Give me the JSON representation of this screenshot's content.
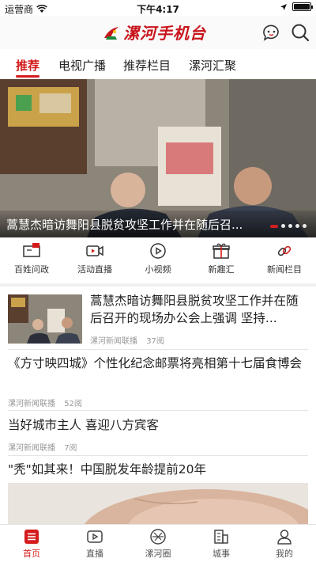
{
  "status_bar": {
    "carrier": "运营商",
    "time": "下午4:17"
  },
  "header": {
    "app_title": "漯河手机台"
  },
  "tabs": [
    {
      "label": "推荐",
      "active": true
    },
    {
      "label": "电视广播",
      "active": false
    },
    {
      "label": "推荐栏目",
      "active": false
    },
    {
      "label": "漯河汇聚",
      "active": false
    }
  ],
  "banner": {
    "title": "蒿慧杰暗访舞阳县脱贫攻坚工作并在随后召...",
    "slide_count": 5,
    "active_slide": 1
  },
  "quick_nav": [
    {
      "label": "百姓问政",
      "icon": "tv-flag-icon"
    },
    {
      "label": "活动直播",
      "icon": "video-camera-icon"
    },
    {
      "label": "小视频",
      "icon": "play-circle-icon"
    },
    {
      "label": "新趣汇",
      "icon": "gift-icon"
    },
    {
      "label": "新闻栏目",
      "icon": "link-icon"
    }
  ],
  "news": [
    {
      "title": "蒿慧杰暗访舞阳县脱贫攻坚工作并在随后召开的现场办公会上强调 坚持...",
      "source": "漯河新闻联播",
      "views": "37阅"
    },
    {
      "title": "《方寸映四城》个性化纪念邮票将亮相第十七届食博会",
      "source": "漯河新闻联播",
      "views": "52阅"
    },
    {
      "title": "当好城市主人 喜迎八方宾客",
      "source": "漯河新闻联播",
      "views": "7阅"
    },
    {
      "title": "\"秃\"如其来！中国脱发年龄提前20年"
    }
  ],
  "bottom_nav": [
    {
      "label": "首页",
      "icon": "home-list-icon",
      "active": true
    },
    {
      "label": "直播",
      "icon": "play-box-icon",
      "active": false
    },
    {
      "label": "漯河圈",
      "icon": "aperture-icon",
      "active": false
    },
    {
      "label": "城事",
      "icon": "building-icon",
      "active": false
    },
    {
      "label": "我的",
      "icon": "user-icon",
      "active": false
    }
  ],
  "colors": {
    "accent": "#d41c1c",
    "logo": "#c8141b"
  }
}
